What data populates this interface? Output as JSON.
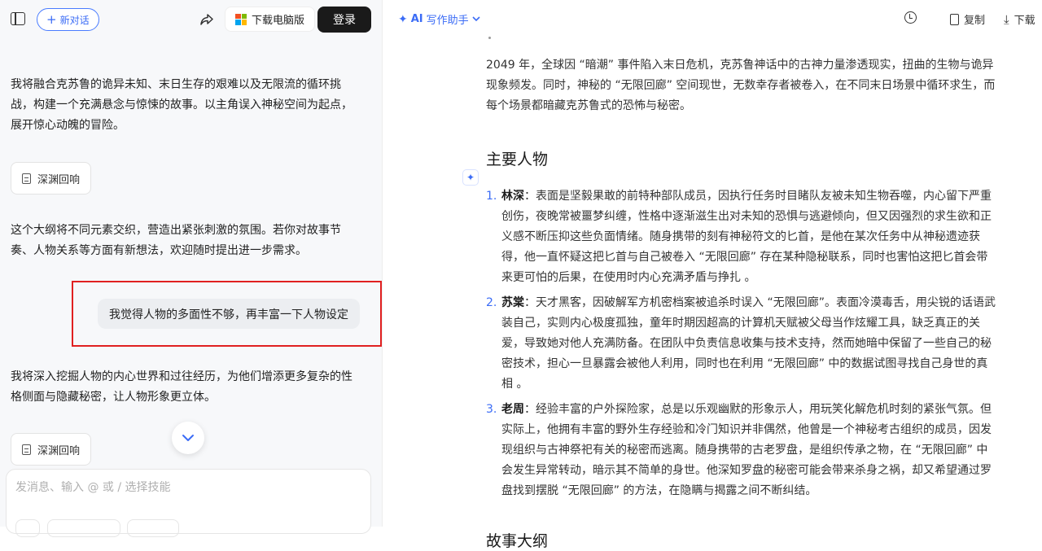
{
  "left": {
    "new_chat_label": "新对话",
    "download_label": "下载电脑版",
    "login_label": "登录",
    "messages": {
      "m1": "我将融合克苏鲁的诡异未知、末日生存的艰难以及无限流的循环挑战，构建一个充满悬念与惊悚的故事。以主角误入神秘空间为起点，展开惊心动魄的冒险。",
      "ref1": "深渊回响",
      "m2": "这个大纲将不同元素交织，营造出紧张刺激的氛围。若你对故事节奏、人物关系等方面有新想法，欢迎随时提出进一步需求。",
      "user": "我觉得人物的多面性不够，再丰富一下人物设定",
      "m3": "我将深入挖掘人物的内心世界和过往经历，为他们增添更多复杂的性格侧面与隐藏秘密，让人物形象更立体。",
      "ref2": "深渊回响"
    },
    "input_placeholder": "发消息、输入 @ 或 / 选择技能",
    "highlight_color": "#e02020"
  },
  "right": {
    "title_ai": "AI",
    "title_text": "写作助手",
    "copy_label": "复制",
    "download_label": "下载",
    "intro": "2049 年，全球因 “暗潮” 事件陷入末日危机，克苏鲁神话中的古神力量渗透现实，扭曲的生物与诡异现象频发。同时，神秘的 “无限回廊” 空间现世，无数幸存者被卷入，在不同末日场景中循环求生，而每个场景都暗藏克苏鲁式的恐怖与秘密。",
    "section_characters": "主要人物",
    "characters": [
      {
        "num": "1.",
        "name": "林深",
        "text": "：表面是坚毅果敢的前特种部队成员，因执行任务时目睹队友被未知生物吞噬，内心留下严重创伤，夜晚常被噩梦纠缠，性格中逐渐滋生出对未知的恐惧与逃避倾向，但又因强烈的求生欲和正义感不断压抑这些负面情绪。随身携带的刻有神秘符文的匕首，是他在某次任务中从神秘遗迹获得，他一直怀疑这把匕首与自己被卷入 “无限回廊” 存在某种隐秘联系，同时也害怕这把匕首会带来更可怕的后果，在使用时内心充满矛盾与挣扎 。"
      },
      {
        "num": "2.",
        "name": "苏棠",
        "text": "：天才黑客，因破解军方机密档案被追杀时误入 “无限回廊”。表面冷漠毒舌，用尖锐的话语武装自己，实则内心极度孤独，童年时期因超高的计算机天赋被父母当作炫耀工具，缺乏真正的关爱，导致她对他人充满防备。在团队中负责信息收集与技术支持，然而她暗中保留了一些自己的秘密技术，担心一旦暴露会被他人利用，同时也在利用 “无限回廊” 中的数据试图寻找自己身世的真相 。"
      },
      {
        "num": "3.",
        "name": "老周",
        "text": "：经验丰富的户外探险家，总是以乐观幽默的形象示人，用玩笑化解危机时刻的紧张气氛。但实际上，他拥有丰富的野外生存经验和冷门知识并非偶然，他曾是一个神秘考古组织的成员，因发现组织与古神祭祀有关的秘密而逃离。随身携带的古老罗盘，是组织传承之物，在 “无限回廊” 中会发生异常转动，暗示其不简单的身世。他深知罗盘的秘密可能会带来杀身之祸，却又希望通过罗盘找到摆脱 “无限回廊” 的方法，在隐瞒与揭露之间不断纠结。"
      }
    ],
    "section_outline": "故事大纲"
  }
}
